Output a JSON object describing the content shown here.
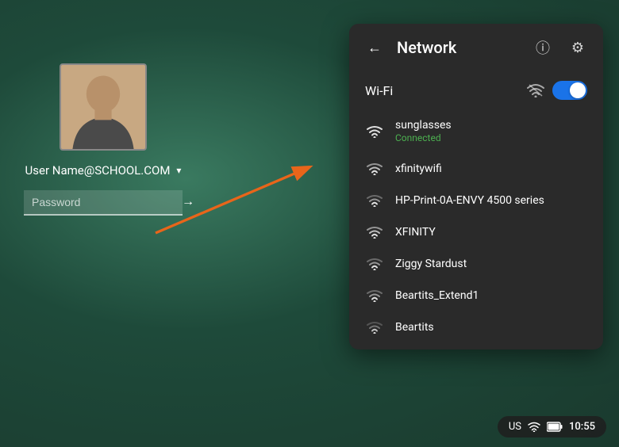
{
  "background": {
    "color": "#2d5a4e"
  },
  "login": {
    "username": "User Name@SCHOOL.COM",
    "password_placeholder": "Password",
    "chevron_label": "▾"
  },
  "network_panel": {
    "title": "Network",
    "back_icon": "←",
    "info_icon": "ⓘ",
    "settings_icon": "⚙",
    "wifi_section": {
      "label": "Wi-Fi",
      "toggle_state": "on"
    },
    "networks": [
      {
        "name": "sunglasses",
        "status": "Connected",
        "connected": true,
        "signal": 4
      },
      {
        "name": "xfinitywifi",
        "status": "",
        "connected": false,
        "signal": 3
      },
      {
        "name": "HP-Print-0A-ENVY 4500 series",
        "status": "",
        "connected": false,
        "signal": 2
      },
      {
        "name": "XFINITY",
        "status": "",
        "connected": false,
        "signal": 3
      },
      {
        "name": "Ziggy Stardust",
        "status": "",
        "connected": false,
        "signal": 2
      },
      {
        "name": "Beartits_Extend1",
        "status": "",
        "connected": false,
        "signal": 2
      },
      {
        "name": "Beartits",
        "status": "",
        "connected": false,
        "signal": 1
      }
    ]
  },
  "status_bar": {
    "locale": "US",
    "time": "10:55",
    "wifi_icon": "wifi",
    "battery_icon": "battery"
  },
  "annotation": {
    "arrow_color": "#e8651a"
  }
}
